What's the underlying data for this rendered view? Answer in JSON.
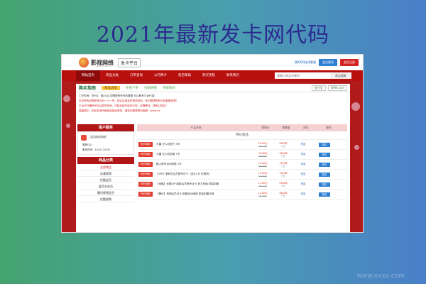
{
  "banner": {
    "title": "2021年最新发卡网代码"
  },
  "header": {
    "logo_text": "影视网络",
    "logo_sub": "good.xxxxx.cn",
    "tag": "发卡平台",
    "user_link": "我的QQ在线客服",
    "btn_login": "会员登录",
    "btn_register": "会员注册"
  },
  "nav": {
    "items": [
      "网站首页",
      "商品分类",
      "订单查询",
      "公司简介",
      "售后帮助",
      "购买流程",
      "联系我们"
    ],
    "search_placeholder": "请输入商品关键词",
    "search_button": "商品搜索"
  },
  "guide": {
    "title": "购买指南",
    "steps": [
      "商品浏览",
      "在线下单",
      "付款链接",
      "完成购买"
    ],
    "partners": [
      "支付宝",
      "WAN.com"
    ]
  },
  "notices": [
    {
      "text": "工作时间：早9点 - 晚24点    如需要有任何问题请 可以联系平台代招！",
      "style": "dark"
    },
    {
      "text": "本站所有出售账号均为一人一号，购买后请及时修改密码，有问题请联系在线客服处理！",
      "style": "red"
    },
    {
      "text": "平台已开通帐号自动发货系统，付款后即可收到卡密，无需等待，请放心购买！",
      "style": "red"
    },
    {
      "text": "温馨提示：购买前请仔细阅读商品说明，遇到问题请联系客服：www.xx",
      "style": "red"
    }
  ],
  "sidebar": {
    "service_title": "客户服务",
    "qq_label": "1234567890",
    "cs_lines": [
      "客服QQ：",
      "服务时间：10:00-24:00"
    ],
    "category_title": "商品分类",
    "categories": [
      "全部商品",
      "动漫视频",
      "优酷会员",
      "爱奇艺会员",
      "腾讯视频会员",
      "优酷视频"
    ]
  },
  "table": {
    "headers": [
      "产品名称",
      "零售价",
      "销售量",
      "库存",
      "操作"
    ],
    "section_title": "特价商品",
    "rows": [
      {
        "tag": "特价商品",
        "name": "大疆 无人机官方 3天",
        "price": "20.00元",
        "old_price": "28.00元",
        "sold_a": "2680件",
        "sold_b": "已售",
        "stock": "充足",
        "action": "购买"
      },
      {
        "tag": "特价商品",
        "name": "大疆 无人机全套 7天",
        "price": "30.00元",
        "old_price": "38.00元",
        "sold_a": "1860件",
        "sold_b": "已售",
        "stock": "充足",
        "action": "购买"
      },
      {
        "tag": "特价商品",
        "name": "输入账号自动到账 2天",
        "price": "15.00元",
        "old_price": "19.00元",
        "sold_a": "1200件",
        "sold_b": "已售",
        "stock": "充足",
        "action": "购买"
      },
      {
        "tag": "特价商品",
        "name": "【VIP】爱奇艺会员账号月卡（送礼2天 仅限购）",
        "price": "15.00元",
        "old_price": "20.00元",
        "sold_a": "7200件",
        "sold_b": "已售",
        "stock": "充足",
        "action": "购买"
      },
      {
        "tag": "特价商品",
        "name": "【优酷】优酷VIP 超级会员账号月卡 官方充值 质保到期",
        "price": "15.00元",
        "old_price": "18.00元",
        "sold_a": "5400件",
        "sold_b": "已售",
        "stock": "充足",
        "action": "购买"
      },
      {
        "tag": "特价商品",
        "name": "【腾讯】视频会员月卡 到期自动续费 质保到期可换",
        "price": "12.00元",
        "old_price": "16.00元",
        "sold_a": "3600件",
        "sold_b": "已售",
        "stock": "充足",
        "action": "购买"
      }
    ]
  },
  "colors": {
    "nav_red": "#b80f0f",
    "accent_blue": "#2f7fd4",
    "title_blue": "#2b2a8f"
  },
  "watermark": "www.xxxx.com"
}
